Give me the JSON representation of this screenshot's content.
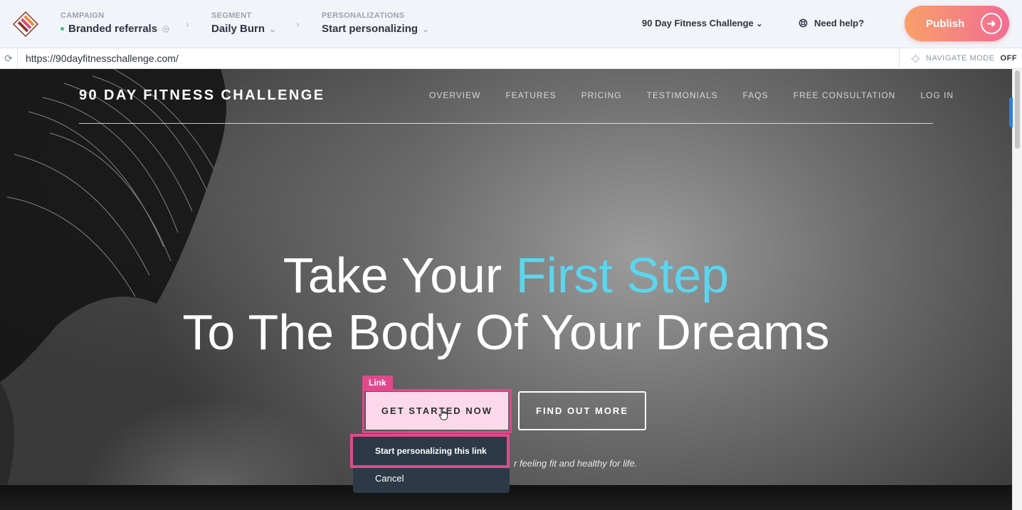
{
  "topbar": {
    "campaign_label": "CAMPAIGN",
    "campaign_value": "Branded referrals",
    "segment_label": "SEGMENT",
    "segment_value": "Daily Burn",
    "personalizations_label": "PERSONALIZATIONS",
    "personalizations_value": "Start personalizing",
    "site_selector": "90 Day Fitness Challenge",
    "help": "Need help?",
    "publish": "Publish"
  },
  "urlbar": {
    "url": "https://90dayfitnesschallenge.com/",
    "navigate_mode_label": "NAVIGATE MODE",
    "navigate_mode_state": "OFF"
  },
  "site": {
    "brand": "90 DAY FITNESS CHALLENGE",
    "nav": [
      "OVERVIEW",
      "FEATURES",
      "PRICING",
      "TESTIMONIALS",
      "FAQS",
      "FREE CONSULTATION",
      "LOG IN"
    ],
    "headline_1_a": "Take Your ",
    "headline_1_b": "First Step",
    "headline_2": "To The Body Of Your Dreams",
    "cta_primary": "GET STARTED NOW",
    "cta_secondary": "FIND OUT MORE",
    "tagline_partial": "r feeling fit and healthy for life."
  },
  "overlay": {
    "element_tag": "Link",
    "menu_primary": "Start personalizing this link",
    "menu_cancel": "Cancel"
  },
  "colors": {
    "accent_highlight": "#e04a8c",
    "headline_accent": "#5ad6ee",
    "publish_gradient_start": "#f8a06a",
    "publish_gradient_end": "#f26c92",
    "menu_bg": "#2c3a47"
  }
}
